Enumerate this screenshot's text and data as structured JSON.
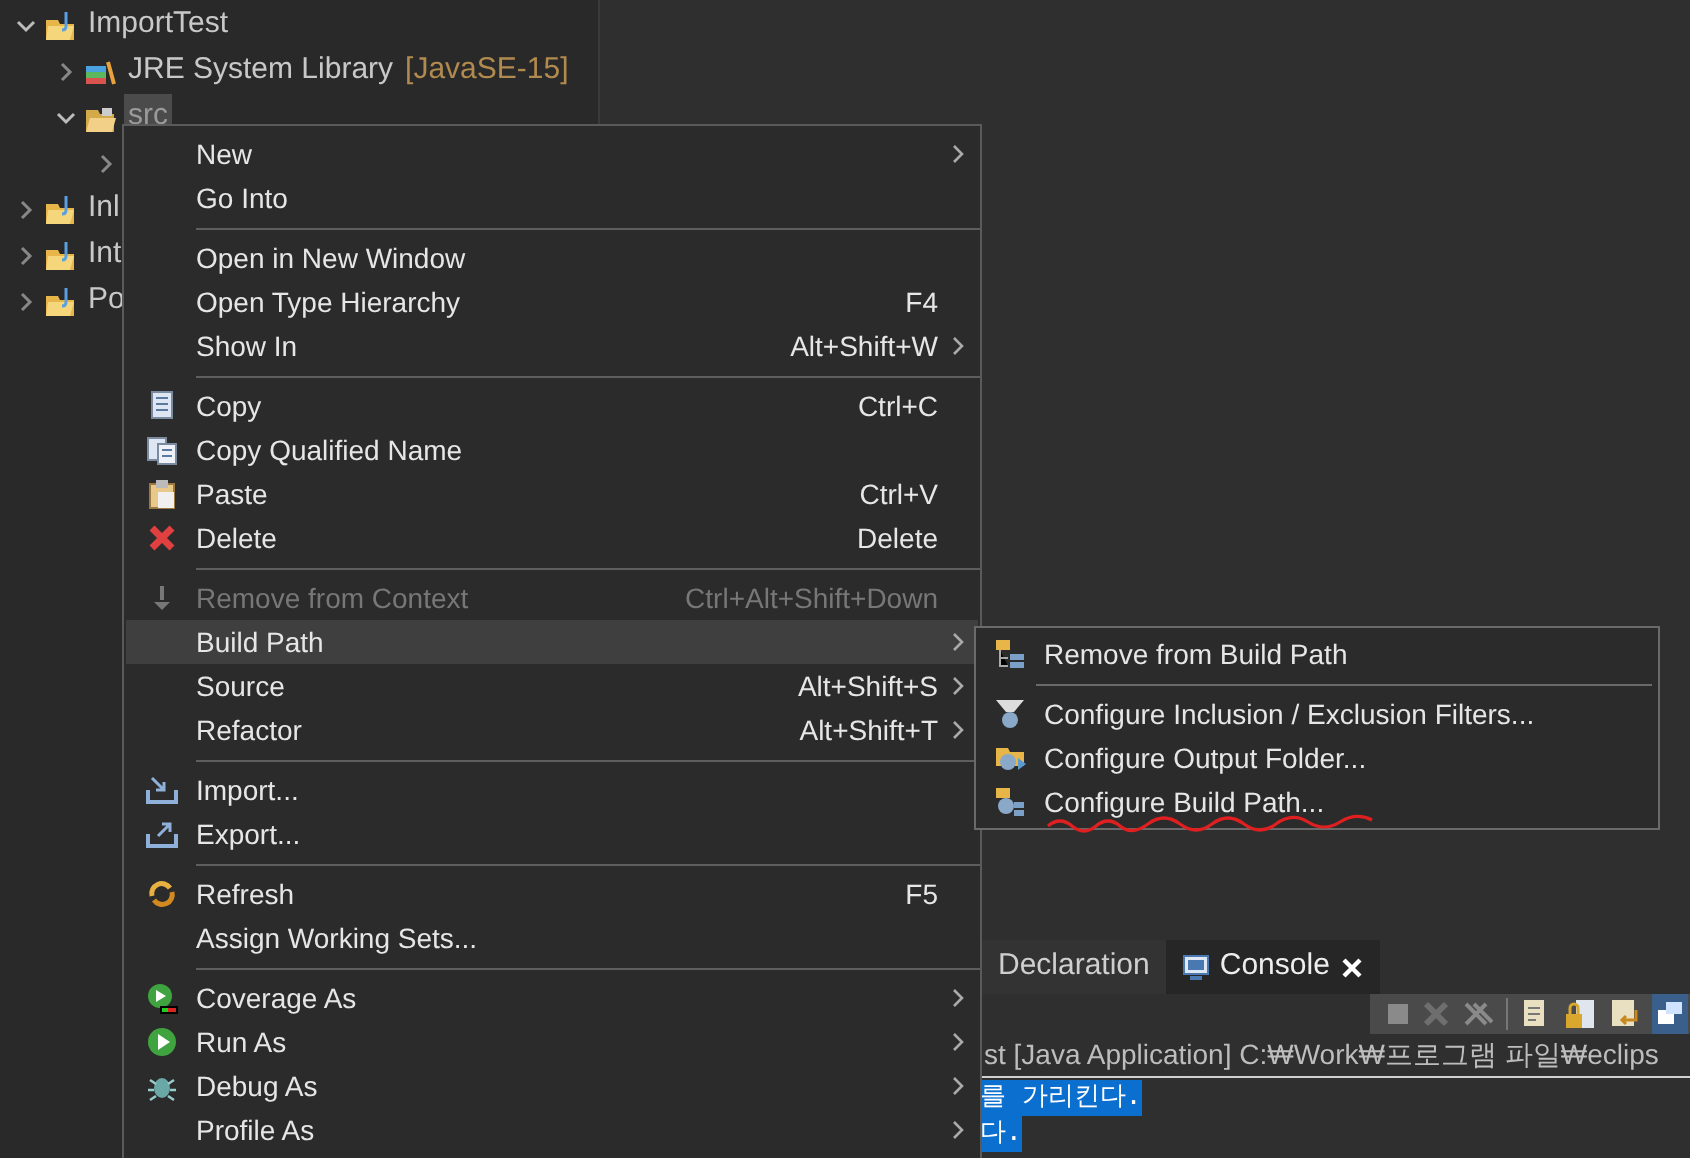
{
  "explorer": {
    "tree": [
      {
        "label": "ImportTest",
        "expanded": true,
        "selected": false,
        "children": [
          {
            "label": "JRE System Library",
            "decoration": "[JavaSE-15]",
            "expanded": false,
            "selected": false
          },
          {
            "label": "src",
            "expanded": true,
            "selected": true,
            "children": [
              {
                "expanded": false
              }
            ]
          }
        ]
      },
      {
        "label": "Inl",
        "expanded": false,
        "selected": false
      },
      {
        "label": "Int",
        "expanded": false,
        "selected": false
      },
      {
        "label": "Po",
        "expanded": false,
        "selected": false
      }
    ]
  },
  "context_menu": {
    "items": [
      {
        "kind": "item",
        "label": "New",
        "submenu": true,
        "disabled": false,
        "selected": false
      },
      {
        "kind": "item",
        "label": "Go Into",
        "submenu": false,
        "disabled": false,
        "selected": false
      },
      {
        "kind": "separator"
      },
      {
        "kind": "item",
        "label": "Open in New Window",
        "submenu": false,
        "disabled": false,
        "selected": false
      },
      {
        "kind": "item",
        "label": "Open Type Hierarchy",
        "shortcut": "F4",
        "submenu": false,
        "disabled": false,
        "selected": false
      },
      {
        "kind": "item",
        "label": "Show In",
        "shortcut": "Alt+Shift+W",
        "submenu": true,
        "disabled": false,
        "selected": false
      },
      {
        "kind": "separator"
      },
      {
        "kind": "item",
        "label": "Copy",
        "shortcut": "Ctrl+C",
        "submenu": false,
        "disabled": false,
        "selected": false
      },
      {
        "kind": "item",
        "label": "Copy Qualified Name",
        "submenu": false,
        "disabled": false,
        "selected": false
      },
      {
        "kind": "item",
        "label": "Paste",
        "shortcut": "Ctrl+V",
        "submenu": false,
        "disabled": false,
        "selected": false
      },
      {
        "kind": "item",
        "label": "Delete",
        "shortcut": "Delete",
        "submenu": false,
        "disabled": false,
        "selected": false
      },
      {
        "kind": "separator"
      },
      {
        "kind": "item",
        "label": "Remove from Context",
        "shortcut": "Ctrl+Alt+Shift+Down",
        "submenu": false,
        "disabled": true,
        "selected": false
      },
      {
        "kind": "item",
        "label": "Build Path",
        "submenu": true,
        "disabled": false,
        "selected": true
      },
      {
        "kind": "item",
        "label": "Source",
        "shortcut": "Alt+Shift+S",
        "submenu": true,
        "disabled": false,
        "selected": false
      },
      {
        "kind": "item",
        "label": "Refactor",
        "shortcut": "Alt+Shift+T",
        "submenu": true,
        "disabled": false,
        "selected": false
      },
      {
        "kind": "separator"
      },
      {
        "kind": "item",
        "label": "Import...",
        "submenu": false,
        "disabled": false,
        "selected": false
      },
      {
        "kind": "item",
        "label": "Export...",
        "submenu": false,
        "disabled": false,
        "selected": false
      },
      {
        "kind": "separator"
      },
      {
        "kind": "item",
        "label": "Refresh",
        "shortcut": "F5",
        "submenu": false,
        "disabled": false,
        "selected": false
      },
      {
        "kind": "item",
        "label": "Assign Working Sets...",
        "submenu": false,
        "disabled": false,
        "selected": false
      },
      {
        "kind": "separator"
      },
      {
        "kind": "item",
        "label": "Coverage As",
        "submenu": true,
        "disabled": false,
        "selected": false
      },
      {
        "kind": "item",
        "label": "Run As",
        "submenu": true,
        "disabled": false,
        "selected": false
      },
      {
        "kind": "item",
        "label": "Debug As",
        "submenu": true,
        "disabled": false,
        "selected": false
      },
      {
        "kind": "item",
        "label": "Profile As",
        "submenu": true,
        "disabled": false,
        "selected": false
      }
    ]
  },
  "build_path_submenu": {
    "items": [
      {
        "kind": "item",
        "label": "Remove from Build Path",
        "underlined": false
      },
      {
        "kind": "separator"
      },
      {
        "kind": "item",
        "label": "Configure Inclusion / Exclusion Filters...",
        "underlined": false
      },
      {
        "kind": "item",
        "label": "Configure Output Folder...",
        "underlined": false
      },
      {
        "kind": "item",
        "label": "Configure Build Path...",
        "underlined": true
      }
    ]
  },
  "bottom_panel": {
    "tabs": [
      {
        "label": "Declaration",
        "selected": false,
        "closable": false
      },
      {
        "label": "Console",
        "selected": true,
        "closable": true
      }
    ],
    "console_header": "st [Java Application] C:₩Work₩프로그램 파일₩eclips",
    "console_lines": [
      {
        "text": "를 가리킨다.",
        "selected": true
      },
      {
        "text": "다.",
        "selected": true
      }
    ]
  }
}
